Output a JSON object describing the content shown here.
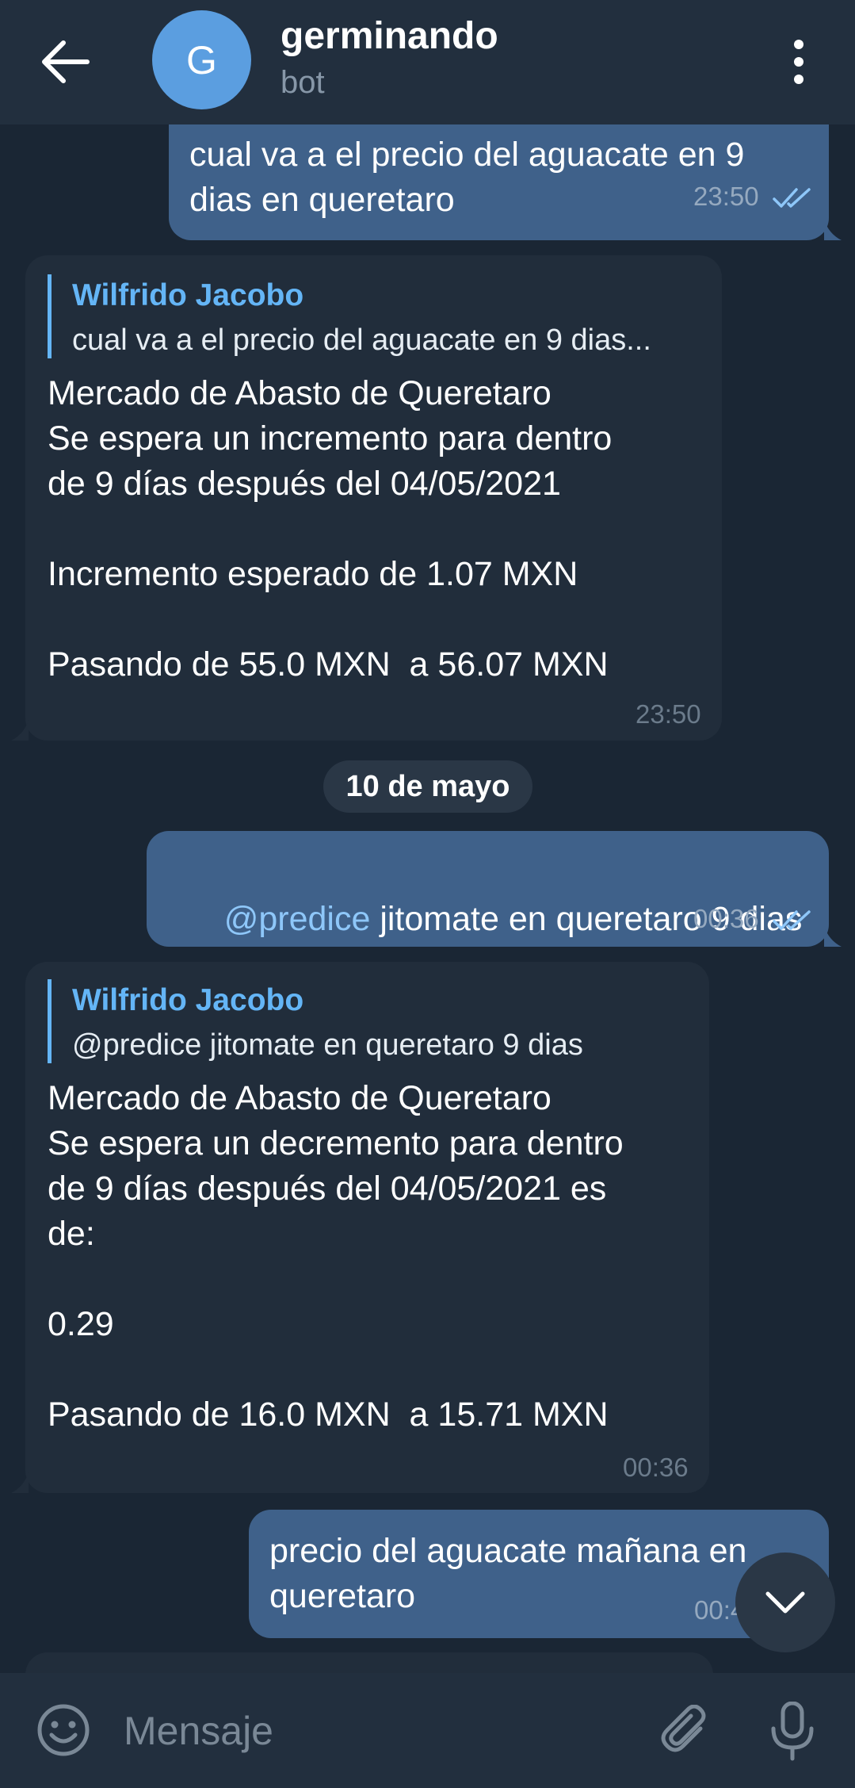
{
  "header": {
    "title": "germinando",
    "subtitle": "bot",
    "avatar_letter": "G"
  },
  "messages": [
    {
      "direction": "outgoing",
      "text": "cual va a el precio del aguacate en 9\ndias en queretaro",
      "time": "23:50",
      "status": "read"
    },
    {
      "direction": "incoming",
      "reply_to": {
        "name": "Wilfrido Jacobo",
        "text": "cual va a el precio del aguacate en 9 dias..."
      },
      "text": "Mercado de Abasto de Queretaro\nSe espera un incremento para dentro\nde 9 días después del 04/05/2021\n\nIncremento esperado de 1.07 MXN\n\nPasando de 55.0 MXN  a 56.07 MXN",
      "time": "23:50"
    },
    {
      "direction": "outgoing",
      "mention": "@predice",
      "text": " jitomate en queretaro 9 dias",
      "time": "00:36",
      "status": "read"
    },
    {
      "direction": "incoming",
      "reply_to": {
        "name": "Wilfrido Jacobo",
        "text": "@predice jitomate en queretaro 9 dias"
      },
      "text": "Mercado de Abasto de Queretaro\nSe espera un decremento para dentro\nde 9 días después del 04/05/2021 es\nde:\n\n0.29\n\nPasando de 16.0 MXN  a 15.71 MXN",
      "time": "00:36"
    },
    {
      "direction": "outgoing",
      "text": "precio del aguacate mañana en\nqueretaro",
      "time": "00:4",
      "status": "read"
    }
  ],
  "date_separator": "10 de mayo",
  "input": {
    "placeholder": "Mensaje"
  },
  "icons": {
    "back": "arrow-left-icon",
    "menu": "more-vertical-icon",
    "emoji": "smile-icon",
    "attach": "paperclip-icon",
    "mic": "microphone-icon",
    "scroll_down": "chevron-down-icon",
    "read_status": "double-check-icon"
  },
  "colors": {
    "background": "#1a2634",
    "header": "#222f3e",
    "outgoing_bubble": "#3f618a",
    "incoming_bubble": "#212d3b",
    "accent": "#64b5f6"
  }
}
